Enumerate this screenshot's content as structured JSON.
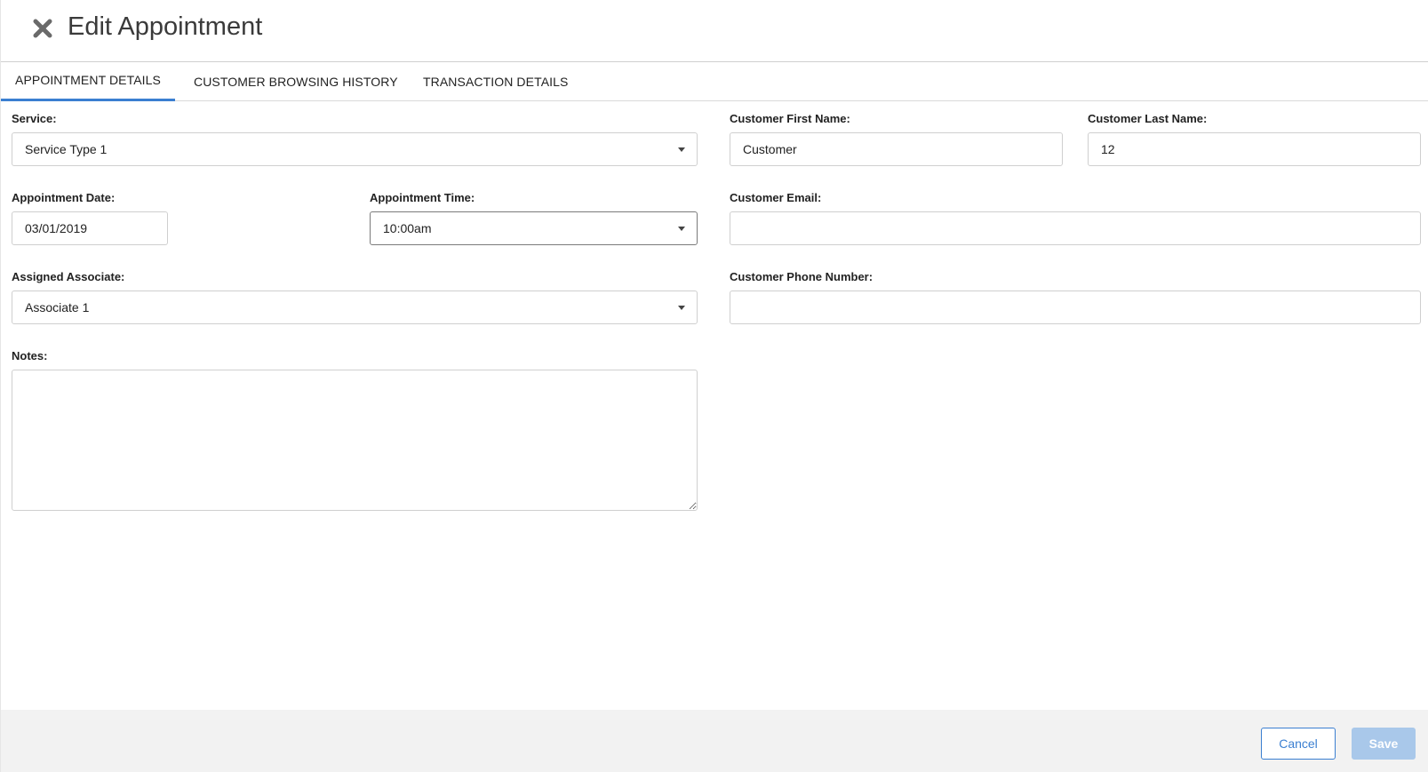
{
  "header": {
    "title": "Edit Appointment",
    "close_icon": "close-icon"
  },
  "tabs": [
    {
      "label": "APPOINTMENT DETAILS",
      "active": true
    },
    {
      "label": "CUSTOMER BROWSING HISTORY",
      "active": false
    },
    {
      "label": "TRANSACTION DETAILS",
      "active": false
    }
  ],
  "form": {
    "service": {
      "label": "Service:",
      "value": "Service Type 1"
    },
    "appointment_date": {
      "label": "Appointment Date:",
      "value": "03/01/2019"
    },
    "appointment_time": {
      "label": "Appointment Time:",
      "value": "10:00am"
    },
    "assigned_associate": {
      "label": "Assigned Associate:",
      "value": "Associate 1"
    },
    "notes": {
      "label": "Notes:",
      "value": ""
    },
    "customer_first_name": {
      "label": "Customer First Name:",
      "value": "Customer"
    },
    "customer_last_name": {
      "label": "Customer Last Name:",
      "value": "12"
    },
    "customer_email": {
      "label": "Customer Email:",
      "value": ""
    },
    "customer_phone": {
      "label": "Customer Phone Number:",
      "value": ""
    }
  },
  "footer": {
    "cancel_label": "Cancel",
    "save_label": "Save"
  },
  "colors": {
    "accent": "#3b7fd1",
    "save_disabled": "#a9c8ea",
    "footer_bg": "#f2f2f2"
  }
}
